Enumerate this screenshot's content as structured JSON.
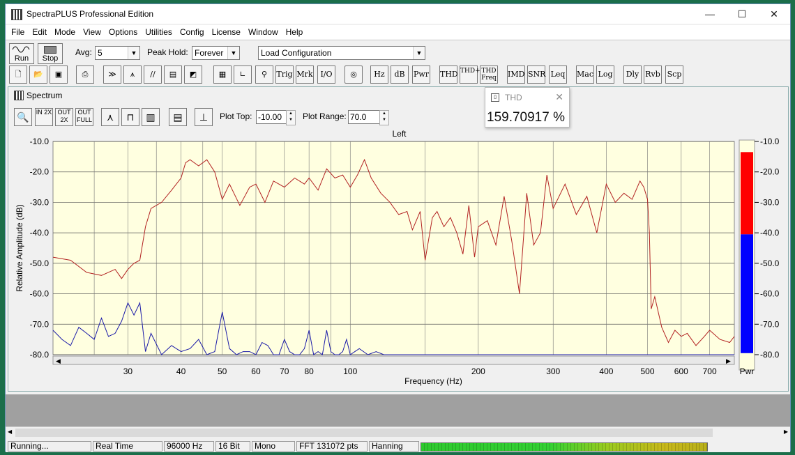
{
  "window": {
    "title": "SpectraPLUS Professional Edition",
    "min": "—",
    "max": "☐",
    "close": "✕"
  },
  "menu": [
    "File",
    "Edit",
    "Mode",
    "View",
    "Options",
    "Utilities",
    "Config",
    "License",
    "Window",
    "Help"
  ],
  "toolbar1": {
    "run_label": "Run",
    "stop_label": "Stop",
    "avg_label": "Avg:",
    "avg_value": "5",
    "peak_label": "Peak Hold:",
    "peak_value": "Forever",
    "config_value": "Load Configuration"
  },
  "toolbar2": {
    "buttons": [
      "Trig",
      "Mrk",
      "I/O",
      "Hz",
      "dB",
      "Pwr",
      "THD",
      "THD+N",
      "THD Freq",
      "IMD",
      "SNR",
      "Leq",
      "Mac",
      "Log",
      "Dly",
      "Rvb",
      "Scp"
    ]
  },
  "spectrum": {
    "title": "Spectrum",
    "zoom": [
      "IN 2X",
      "OUT 2X",
      "OUT FULL"
    ],
    "plot_top_label": "Plot Top:",
    "plot_top_value": "-10.00",
    "plot_range_label": "Plot Range:",
    "plot_range_value": "70.0"
  },
  "thd_popup": {
    "title": "THD",
    "value": "159.70917 %",
    "close": "✕"
  },
  "chart_data": {
    "type": "line",
    "title": "Left",
    "xlabel": "Frequency (Hz)",
    "ylabel": "Relative Amplitude (dB)",
    "xscale": "log",
    "xlim": [
      20,
      800
    ],
    "ylim": [
      -80,
      -10
    ],
    "xticks": [
      30,
      40,
      50,
      60,
      70,
      80,
      100,
      200,
      300,
      400,
      500,
      600,
      700
    ],
    "yticks": [
      -10,
      -20,
      -30,
      -40,
      -50,
      -60,
      -70,
      -80
    ],
    "ytick_labels": [
      "-10.0",
      "-20.0",
      "-30.0",
      "-40.0",
      "-50.0",
      "-60.0",
      "-70.0",
      "-80.0"
    ],
    "grid": true,
    "series": [
      {
        "color": "#b22222",
        "x": [
          20,
          22,
          24,
          26,
          28,
          29,
          30,
          31,
          32,
          33,
          34,
          36,
          38,
          40,
          41,
          42,
          44,
          46,
          48,
          50,
          52,
          55,
          58,
          60,
          63,
          66,
          70,
          74,
          78,
          80,
          84,
          88,
          92,
          96,
          100,
          104,
          108,
          112,
          118,
          124,
          130,
          136,
          140,
          146,
          150,
          156,
          160,
          166,
          172,
          178,
          184,
          190,
          196,
          200,
          210,
          220,
          230,
          240,
          250,
          260,
          270,
          280,
          290,
          300,
          320,
          340,
          360,
          380,
          400,
          420,
          440,
          460,
          480,
          490,
          500,
          505,
          510,
          520,
          540,
          560,
          580,
          600,
          620,
          650,
          680,
          700,
          740,
          780,
          800
        ],
        "y": [
          -48,
          -49,
          -53,
          -54,
          -52,
          -55,
          -52,
          -50,
          -49,
          -38,
          -32,
          -30,
          -26,
          -22,
          -17,
          -16,
          -18,
          -16,
          -20,
          -29,
          -24,
          -31,
          -25,
          -24,
          -30,
          -23,
          -25,
          -22,
          -24,
          -22,
          -26,
          -19,
          -22,
          -21,
          -25,
          -21,
          -16,
          -22,
          -27,
          -30,
          -34,
          -33,
          -39,
          -33,
          -49,
          -35,
          -33,
          -38,
          -35,
          -40,
          -47,
          -31,
          -48,
          -38,
          -36,
          -44,
          -28,
          -43,
          -60,
          -27,
          -44,
          -40,
          -21,
          -32,
          -24,
          -34,
          -28,
          -40,
          -24,
          -30,
          -27,
          -29,
          -23,
          -25,
          -29,
          -40,
          -65,
          -61,
          -71,
          -76,
          -72,
          -74,
          -73,
          -77,
          -74,
          -72,
          -75,
          -76,
          -74
        ]
      },
      {
        "color": "#1a1aa8",
        "x": [
          20,
          21,
          22,
          23,
          24,
          25,
          26,
          27,
          28,
          29,
          30,
          31,
          32,
          33,
          34,
          36,
          38,
          40,
          42,
          44,
          46,
          48,
          50,
          52,
          54,
          56,
          58,
          60,
          62,
          64,
          66,
          68,
          70,
          72,
          74,
          76,
          78,
          80,
          82,
          84,
          86,
          88,
          90,
          92,
          94,
          96,
          98,
          100,
          105,
          110,
          115,
          120,
          130,
          140,
          150,
          160,
          200,
          300,
          400,
          500,
          600,
          700,
          800
        ],
        "y": [
          -72,
          -75,
          -77,
          -71,
          -73,
          -75,
          -68,
          -74,
          -73,
          -69,
          -63,
          -67,
          -63,
          -79,
          -73,
          -80,
          -77,
          -79,
          -78,
          -75,
          -80,
          -79,
          -66,
          -78,
          -80,
          -79,
          -79,
          -80,
          -76,
          -77,
          -80,
          -80,
          -75,
          -79,
          -80,
          -80,
          -78,
          -72,
          -80,
          -79,
          -80,
          -72,
          -79,
          -80,
          -80,
          -79,
          -75,
          -80,
          -78,
          -80,
          -79,
          -80,
          -80,
          -80,
          -80,
          -80,
          -80,
          -80,
          -80,
          -80,
          -80,
          -80,
          -80
        ]
      }
    ],
    "power_bar": {
      "ymin": -80,
      "ymax": -10,
      "red_top": -13.5,
      "red_bottom": -40.5,
      "blue_bottom": -79.5,
      "label": "Pwr"
    }
  },
  "status": {
    "state": "Running...",
    "mode": "Real Time",
    "rate": "96000 Hz",
    "bits": "16 Bit",
    "channels": "Mono",
    "fft": "FFT 131072 pts",
    "window": "Hanning",
    "meter_level": 0.75
  }
}
